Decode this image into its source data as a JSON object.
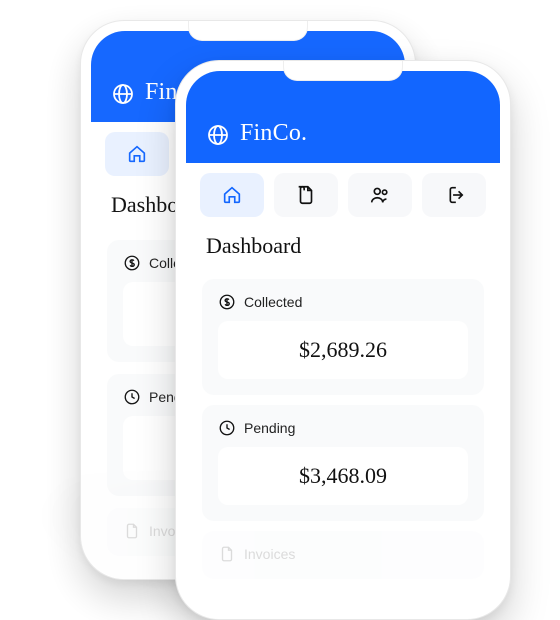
{
  "brand": {
    "name": "FinCo."
  },
  "nav": {
    "items": [
      {
        "name": "home",
        "active": true
      },
      {
        "name": "documents",
        "active": false
      },
      {
        "name": "users",
        "active": false
      },
      {
        "name": "logout",
        "active": false
      }
    ]
  },
  "page": {
    "title": "Dashboard"
  },
  "cards": {
    "collected": {
      "label": "Collected",
      "value": "$2,689.26"
    },
    "pending": {
      "label": "Pending",
      "value": "$3,468.09"
    },
    "invoices": {
      "label": "Invoices"
    }
  }
}
